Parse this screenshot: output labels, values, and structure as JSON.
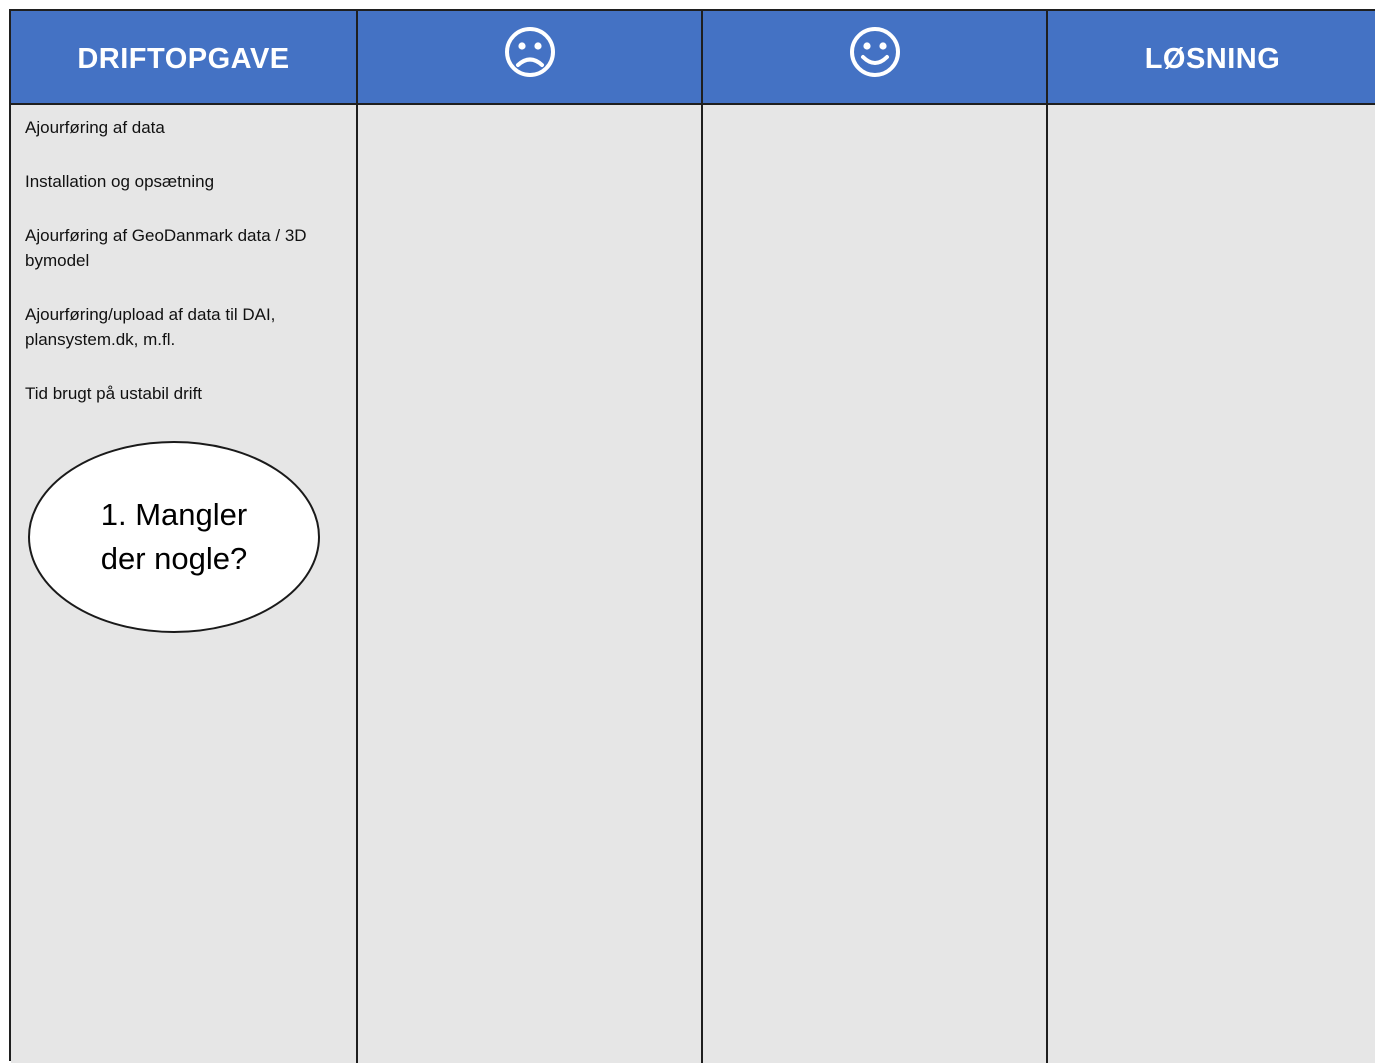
{
  "header": {
    "col1_title": "DRIFTOPGAVE",
    "col2_icon": "sad-face-icon",
    "col3_icon": "smiley-face-icon",
    "col4_title": "LØSNING"
  },
  "tasks": [
    "Ajourføring af data",
    "Installation og opsætning",
    "Ajourføring af GeoDanmark data / 3D bymodel",
    "Ajourføring/upload af data til DAI, plansystem.dk, m.fl.",
    "Tid brugt på ustabil drift"
  ],
  "callout": {
    "text": "1. Mangler\nder nogle?"
  },
  "colors": {
    "header_bg": "#4472c4",
    "cell_bg": "#e6e6e6",
    "grid_line": "#1f1f1f"
  }
}
